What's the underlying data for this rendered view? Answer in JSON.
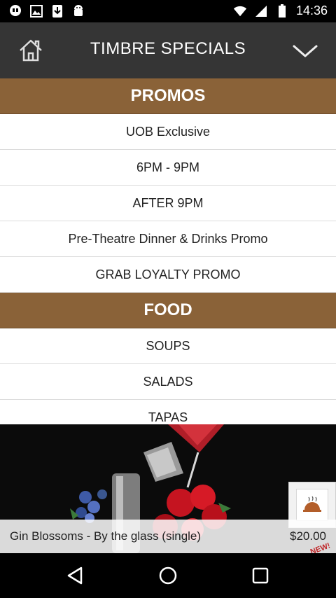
{
  "status_bar": {
    "time": "14:36",
    "left_icons": [
      "chat-bubble-icon",
      "image-icon",
      "download-icon",
      "android-icon"
    ],
    "right_icons": [
      "wifi-icon",
      "signal-icon",
      "battery-icon"
    ]
  },
  "app_bar": {
    "title": "TIMBRE SPECIALS",
    "home_icon": "home-icon",
    "menu_icon": "chevron-down-icon"
  },
  "sections": [
    {
      "header": "PROMOS",
      "items": [
        "UOB Exclusive",
        "6PM - 9PM",
        "AFTER 9PM",
        "Pre-Theatre Dinner & Drinks Promo",
        "GRAB LOYALTY PROMO"
      ]
    },
    {
      "header": "FOOD",
      "items": [
        "SOUPS",
        "SALADS",
        "TAPAS"
      ]
    }
  ],
  "banner": {
    "item_name": "Gin Blossoms - By the glass (single)",
    "price": "$20.00",
    "tag": "NEW!",
    "food_button_icon": "serving-cloche-icon"
  },
  "nav_bar": {
    "icons": [
      "back-triangle-icon",
      "home-circle-icon",
      "recents-square-icon"
    ]
  },
  "colors": {
    "app_bar": "#353535",
    "section_header": "#8a6238",
    "status_bar": "#000000"
  }
}
